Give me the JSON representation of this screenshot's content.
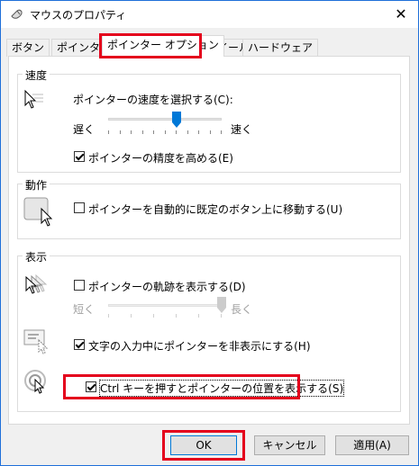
{
  "window": {
    "title": "マウスのプロパティ",
    "close_glyph": "✕"
  },
  "tabs": [
    {
      "label": "ボタン"
    },
    {
      "label": "ポインター"
    },
    {
      "label": "ポインター オプション"
    },
    {
      "label": "ホイール"
    },
    {
      "label": "ハードウェア"
    }
  ],
  "motion": {
    "group_label": "速度",
    "speed_label": "ポインターの速度を選択する(C):",
    "slow": "遅く",
    "fast": "速く",
    "speed_level": 0.6,
    "precision_label": "ポインターの精度を高める(E)",
    "precision_checked": true
  },
  "snap": {
    "group_label": "動作",
    "label": "ポインターを自動的に既定のボタン上に移動する(U)",
    "checked": false
  },
  "visibility": {
    "group_label": "表示",
    "trails_label": "ポインターの軌跡を表示する(D)",
    "trails_checked": false,
    "short": "短く",
    "long": "長く",
    "trails_level": 1.0,
    "hide_label": "文字の入力中にポインターを非表示にする(H)",
    "hide_checked": true,
    "ctrl_label": "Ctrl キーを押すとポインターの位置を表示する(S)",
    "ctrl_checked": true
  },
  "buttons": {
    "ok": "OK",
    "cancel": "キャンセル",
    "apply": "適用(A)"
  },
  "colors": {
    "highlight": "#e4001c",
    "accent": "#0078d7"
  }
}
